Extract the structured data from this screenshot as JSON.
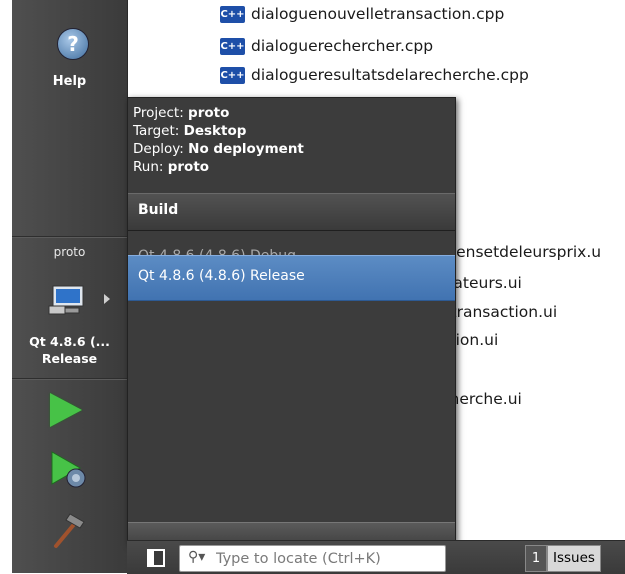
{
  "files": [
    {
      "name": "dialoguenouvelletransaction.cpp",
      "icon": "cpp-icon",
      "icon_label": "C++"
    },
    {
      "name": "dialoguerechercher.cpp",
      "icon": "cpp-icon",
      "icon_label": "C++"
    },
    {
      "name": "dialogueresultatsdelarecherche.cpp",
      "icon": "cpp-icon",
      "icon_label": "C++"
    }
  ],
  "ui_files_partial": [
    "mensetdeleursprix.u",
    "isateurs.ui",
    "etransaction.ui",
    "ction.ui",
    "cherche.ui"
  ],
  "sidebar": {
    "help_label": "Help",
    "help_glyph": "?",
    "kit_project": "proto",
    "kit_name": "Qt 4.8.6 (...",
    "kit_config": "Release",
    "run_icon": "run-icon",
    "debug_icon": "debug-run-icon",
    "build_icon": "hammer-icon"
  },
  "popup": {
    "project_label": "Project:",
    "project_value": "proto",
    "target_label": "Target:",
    "target_value": "Desktop",
    "deploy_label": "Deploy:",
    "deploy_value": "No deployment",
    "run_label": "Run:",
    "run_value": "proto",
    "build_header": "Build",
    "configs": [
      {
        "label": "Qt 4.8.6 (4.8.6) Debug",
        "selected": false
      },
      {
        "label": "Qt 4.8.6 (4.8.6) Release",
        "selected": true
      }
    ]
  },
  "status_bar": {
    "locator_placeholder": "Type to locate (Ctrl+K)",
    "locator_icon": "search-icon",
    "issues_count": "1",
    "issues_label": "Issues"
  },
  "colors": {
    "selection": "#4a7fc0",
    "sidebar_bg": "#444444",
    "popup_bg": "#3c3c3c",
    "run_green": "#47c247"
  }
}
